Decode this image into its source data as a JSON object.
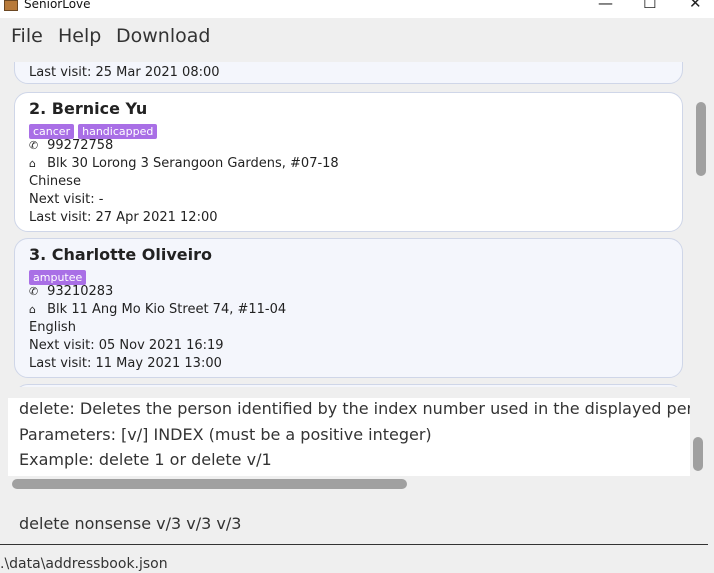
{
  "window": {
    "title": "SeniorLove",
    "minimize_glyph": "—",
    "maximize_glyph": "☐",
    "close_glyph": "✕"
  },
  "menu": {
    "items": [
      "File",
      "Help",
      "Download"
    ]
  },
  "persons": {
    "prev_last_visit": "Last visit: 25 Mar 2021 08:00",
    "p2": {
      "name": "2.  Bernice Yu",
      "tags": [
        "cancer",
        "handicapped"
      ],
      "phone": "99272758",
      "address": "Blk 30 Lorong 3 Serangoon Gardens, #07-18",
      "language": "Chinese",
      "next_visit": "Next visit: -",
      "last_visit": "Last visit: 27 Apr 2021 12:00"
    },
    "p3": {
      "name": "3.  Charlotte Oliveiro",
      "tags": [
        "amputee"
      ],
      "phone": "93210283",
      "address": "Blk 11 Ang Mo Kio Street 74, #11-04",
      "language": "English",
      "next_visit": "Next visit: 05 Nov 2021 16:19",
      "last_visit": "Last visit: 11 May 2021 13:00"
    }
  },
  "icons": {
    "phone": "phone-icon",
    "home": "home-icon"
  },
  "result": {
    "line1": "delete: Deletes the person identified by the index number used in the displayed person",
    "line2": "Parameters: [v/] INDEX (must be a positive integer)",
    "line3": "Example: delete 1 or delete v/1"
  },
  "command_text": "delete nonsense v/3 v/3 v/3",
  "status_path": ".\\data\\addressbook.json",
  "colors": {
    "tag": "#a96fe6",
    "card_bg": "#f4f6fc"
  }
}
